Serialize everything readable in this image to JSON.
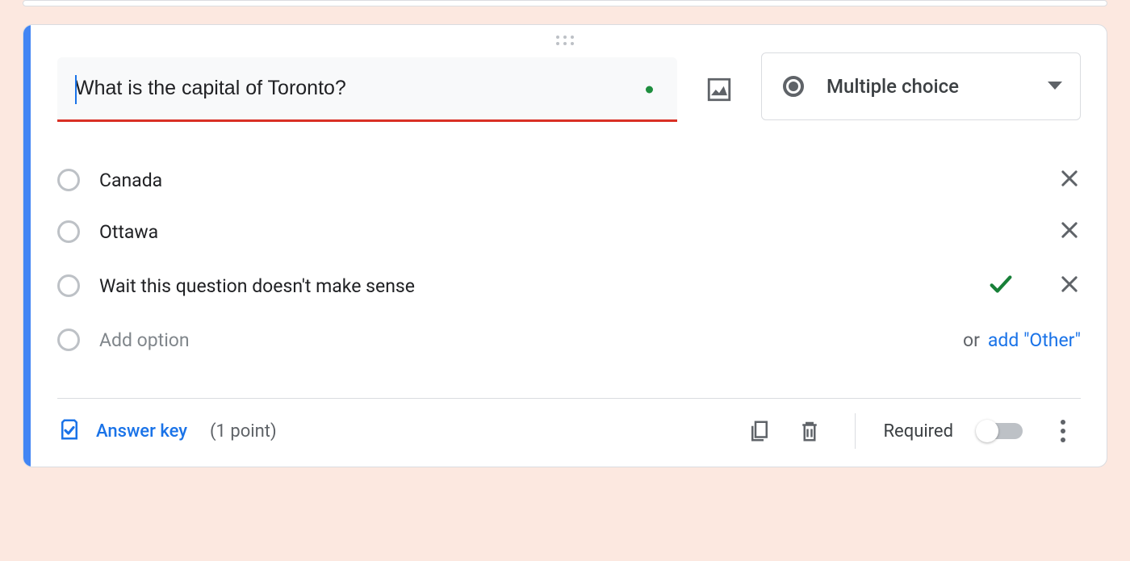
{
  "question": {
    "text": "What is the capital of Toronto?",
    "type_label": "Multiple choice"
  },
  "options": [
    {
      "label": "Canada",
      "correct": false
    },
    {
      "label": "Ottawa",
      "correct": false
    },
    {
      "label": "Wait this question doesn't make sense",
      "correct": true
    }
  ],
  "add_option": {
    "placeholder": "Add option",
    "or": "or",
    "add_other": "add \"Other\""
  },
  "footer": {
    "answer_key": "Answer key",
    "points": "(1 point)",
    "required": "Required"
  }
}
